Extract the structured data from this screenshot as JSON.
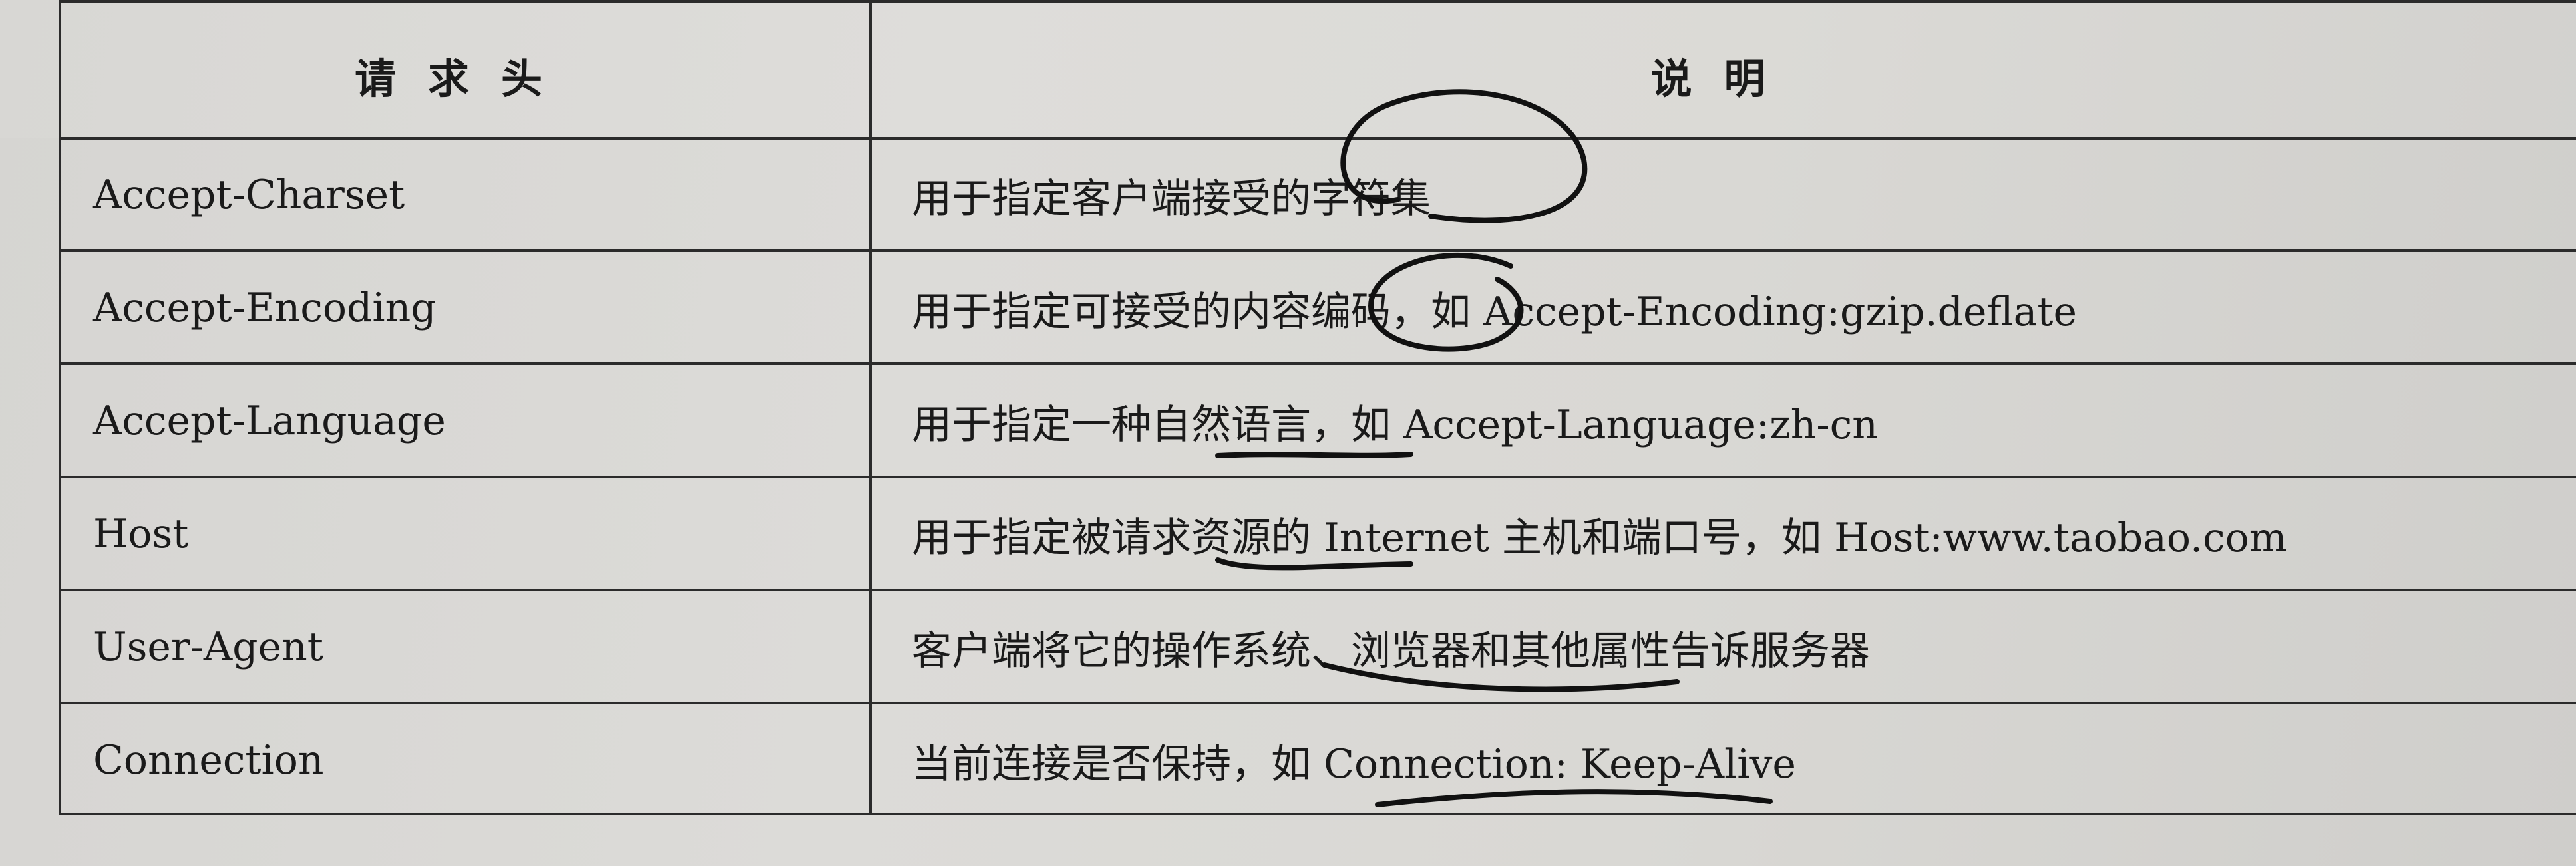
{
  "table": {
    "headers": [
      "请求头",
      "说明"
    ],
    "rows": [
      {
        "name": "Accept-Charset",
        "desc": "用于指定客户端接受的字符集"
      },
      {
        "name": "Accept-Encoding",
        "desc": "用于指定可接受的内容编码，如 Accept-Encoding:gzip.deflate"
      },
      {
        "name": "Accept-Language",
        "desc": "用于指定一种自然语言，如 Accept-Language:zh-cn"
      },
      {
        "name": "Host",
        "desc": "用于指定被请求资源的 Internet 主机和端口号，如 Host:www.taobao.com"
      },
      {
        "name": "User-Agent",
        "desc": "客户端将它的操作系统、浏览器和其他属性告诉服务器"
      },
      {
        "name": "Connection",
        "desc": "当前连接是否保持，如 Connection: Keep-Alive"
      }
    ]
  },
  "annotations": {
    "ink_color": "#111111"
  }
}
